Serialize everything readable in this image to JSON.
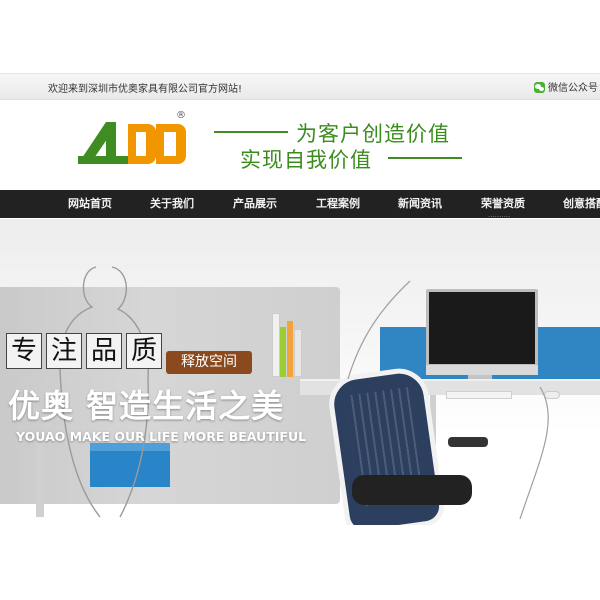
{
  "topbar": {
    "welcome_text": "欢迎来到深圳市优奥家具有限公司官方网站!",
    "wechat_label": "微信公众号：",
    "wechat_icon": "wechat-icon"
  },
  "header": {
    "logo_text": "AO",
    "logo_reg_mark": "®",
    "slogan_line1": "为客户创造价值",
    "slogan_line2": "实现自我价值",
    "colors": {
      "slogan": "#3a8d1d",
      "logo_green": "#3f8d22",
      "logo_orange": "#f29600"
    }
  },
  "nav": {
    "items": [
      {
        "label": "网站首页"
      },
      {
        "label": "关于我们"
      },
      {
        "label": "产品展示"
      },
      {
        "label": "工程案例"
      },
      {
        "label": "新闻资讯"
      },
      {
        "label": "荣誉资质"
      },
      {
        "label": "创意搭配"
      }
    ],
    "tail_text": "..........",
    "colors": {
      "background": "#222222",
      "text": "#f2f2f2"
    }
  },
  "banner": {
    "tag_chars": [
      "专",
      "注",
      "品",
      "质"
    ],
    "release_label": "释放空间",
    "headline": "优奥 智造生活之美",
    "subline": "YOUAO MAKE OUR LIFE MORE BEAUTIFUL",
    "colors": {
      "partition": "#2f86c2",
      "release_bg": "#8a4a1d"
    }
  }
}
